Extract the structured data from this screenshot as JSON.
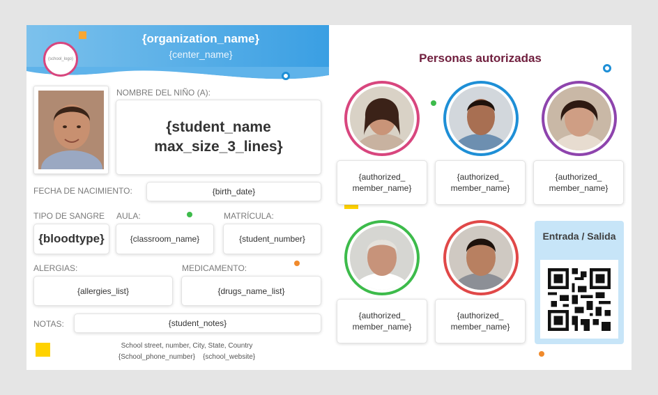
{
  "header": {
    "logo_text": "(school_logo)",
    "organization": "{organization_name}",
    "center": "{center_name}"
  },
  "student": {
    "name_label": "NOMBRE DEL NIÑO (A):",
    "name": "{student_name max_size_3_lines}",
    "birth_label": "FECHA DE NACIMIENTO:",
    "birth": "{birth_date}",
    "blood_label": "TIPO DE SANGRE",
    "blood": "{bloodtype}",
    "classroom_label": "AULA:",
    "classroom": "{classroom_name}",
    "number_label": "MATRÍCULA:",
    "number": "{student_number}",
    "allergies_label": "ALERGIAS:",
    "allergies": "{allergies_list}",
    "drugs_label": "MEDICAMENTO:",
    "drugs": "{drugs_name_list}",
    "notes_label": "NOTAS:",
    "notes": "{student_notes}"
  },
  "footer": {
    "address": "School street, number, City, State, Country",
    "contact": "{School_phone_number}    {school_website}"
  },
  "authorized": {
    "title": "Personas autorizadas",
    "members": [
      {
        "name": "{authorized_ member_name}",
        "ring": "#d8467e"
      },
      {
        "name": "{authorized_ member_name}",
        "ring": "#1e8fd6"
      },
      {
        "name": "{authorized_ member_name}",
        "ring": "#8e44ad"
      },
      {
        "name": "{authorized_ member_name}",
        "ring": "#3dbb4b"
      },
      {
        "name": "{authorized_ member_name}",
        "ring": "#e04848"
      }
    ]
  },
  "qr": {
    "title": "Entrada / Salida"
  },
  "colors": {
    "accent_blue": "#3a9fe3",
    "title_maroon": "#701f3e",
    "qr_panel": "#c7e5f8",
    "yellow": "#ffd200"
  }
}
